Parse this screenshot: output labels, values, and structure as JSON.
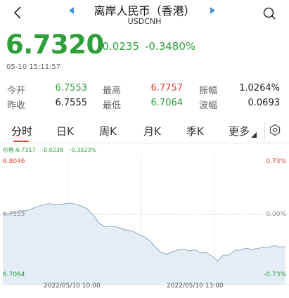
{
  "header": {
    "title": "离岸人民币（香港）",
    "subtitle": "USDCNH"
  },
  "quote": {
    "price": "6.7320",
    "change": "-0.0235",
    "change_pct": "-0.3480%",
    "timestamp": "05-10 15:11:57"
  },
  "stats": [
    {
      "label": "今开",
      "value": "6.7553",
      "color": "#2e9e3b"
    },
    {
      "label": "最高",
      "value": "6.7757",
      "color": "#e0443a"
    },
    {
      "label": "振幅",
      "value": "1.0264%",
      "color": "#222222"
    },
    {
      "label": "昨收",
      "value": "6.7555",
      "color": "#222222"
    },
    {
      "label": "最低",
      "value": "6.7064",
      "color": "#2e9e3b"
    },
    {
      "label": "波幅",
      "value": "0.0693",
      "color": "#222222"
    }
  ],
  "tabs": [
    {
      "label": "分时",
      "active": true
    },
    {
      "label": "日K",
      "active": false
    },
    {
      "label": "周K",
      "active": false
    },
    {
      "label": "月K",
      "active": false
    },
    {
      "label": "季K",
      "active": false
    },
    {
      "label": "更多",
      "active": false
    }
  ],
  "chart_info": {
    "price_label": "价格:6.7317",
    "change": "-0.0238",
    "change_pct": "-0.3523%"
  },
  "chart_data": {
    "type": "area",
    "y_left_labels": {
      "top": "6.8046",
      "mid": "6.7555",
      "bottom": "6.7064"
    },
    "y_right_labels": {
      "top": "0.73%",
      "mid": "0.00%",
      "bottom": "-0.73%"
    },
    "x_labels": [
      "2022/05/10 10:00",
      "2022/05/10 13:00"
    ],
    "ylim": [
      6.7064,
      6.8046
    ],
    "reference_price": 6.7555,
    "series": [
      {
        "values": [
          6.7565,
          6.7563,
          6.757,
          6.759,
          6.7588,
          6.7605,
          6.7625,
          6.764,
          6.7655,
          6.765,
          6.7645,
          6.7655,
          6.766,
          6.7648,
          6.763,
          6.7605,
          6.755,
          6.7475,
          6.744,
          6.7445,
          6.744,
          6.7425,
          6.7405,
          6.7398,
          6.737,
          6.7345,
          6.731,
          6.725,
          6.72,
          6.7185,
          6.7205,
          6.7225,
          6.723,
          6.7215,
          6.7225,
          6.7195,
          6.72,
          6.7165,
          6.712,
          6.7175,
          6.7175,
          6.7215,
          6.7225,
          6.724,
          6.723,
          6.7235,
          6.725,
          6.7245,
          6.7265,
          6.725,
          6.7255
        ],
        "color": "#8fa8bf"
      }
    ]
  },
  "colors": {
    "up": "#e0443a",
    "down": "#2e9e3b",
    "line": "#8fa8bf"
  }
}
